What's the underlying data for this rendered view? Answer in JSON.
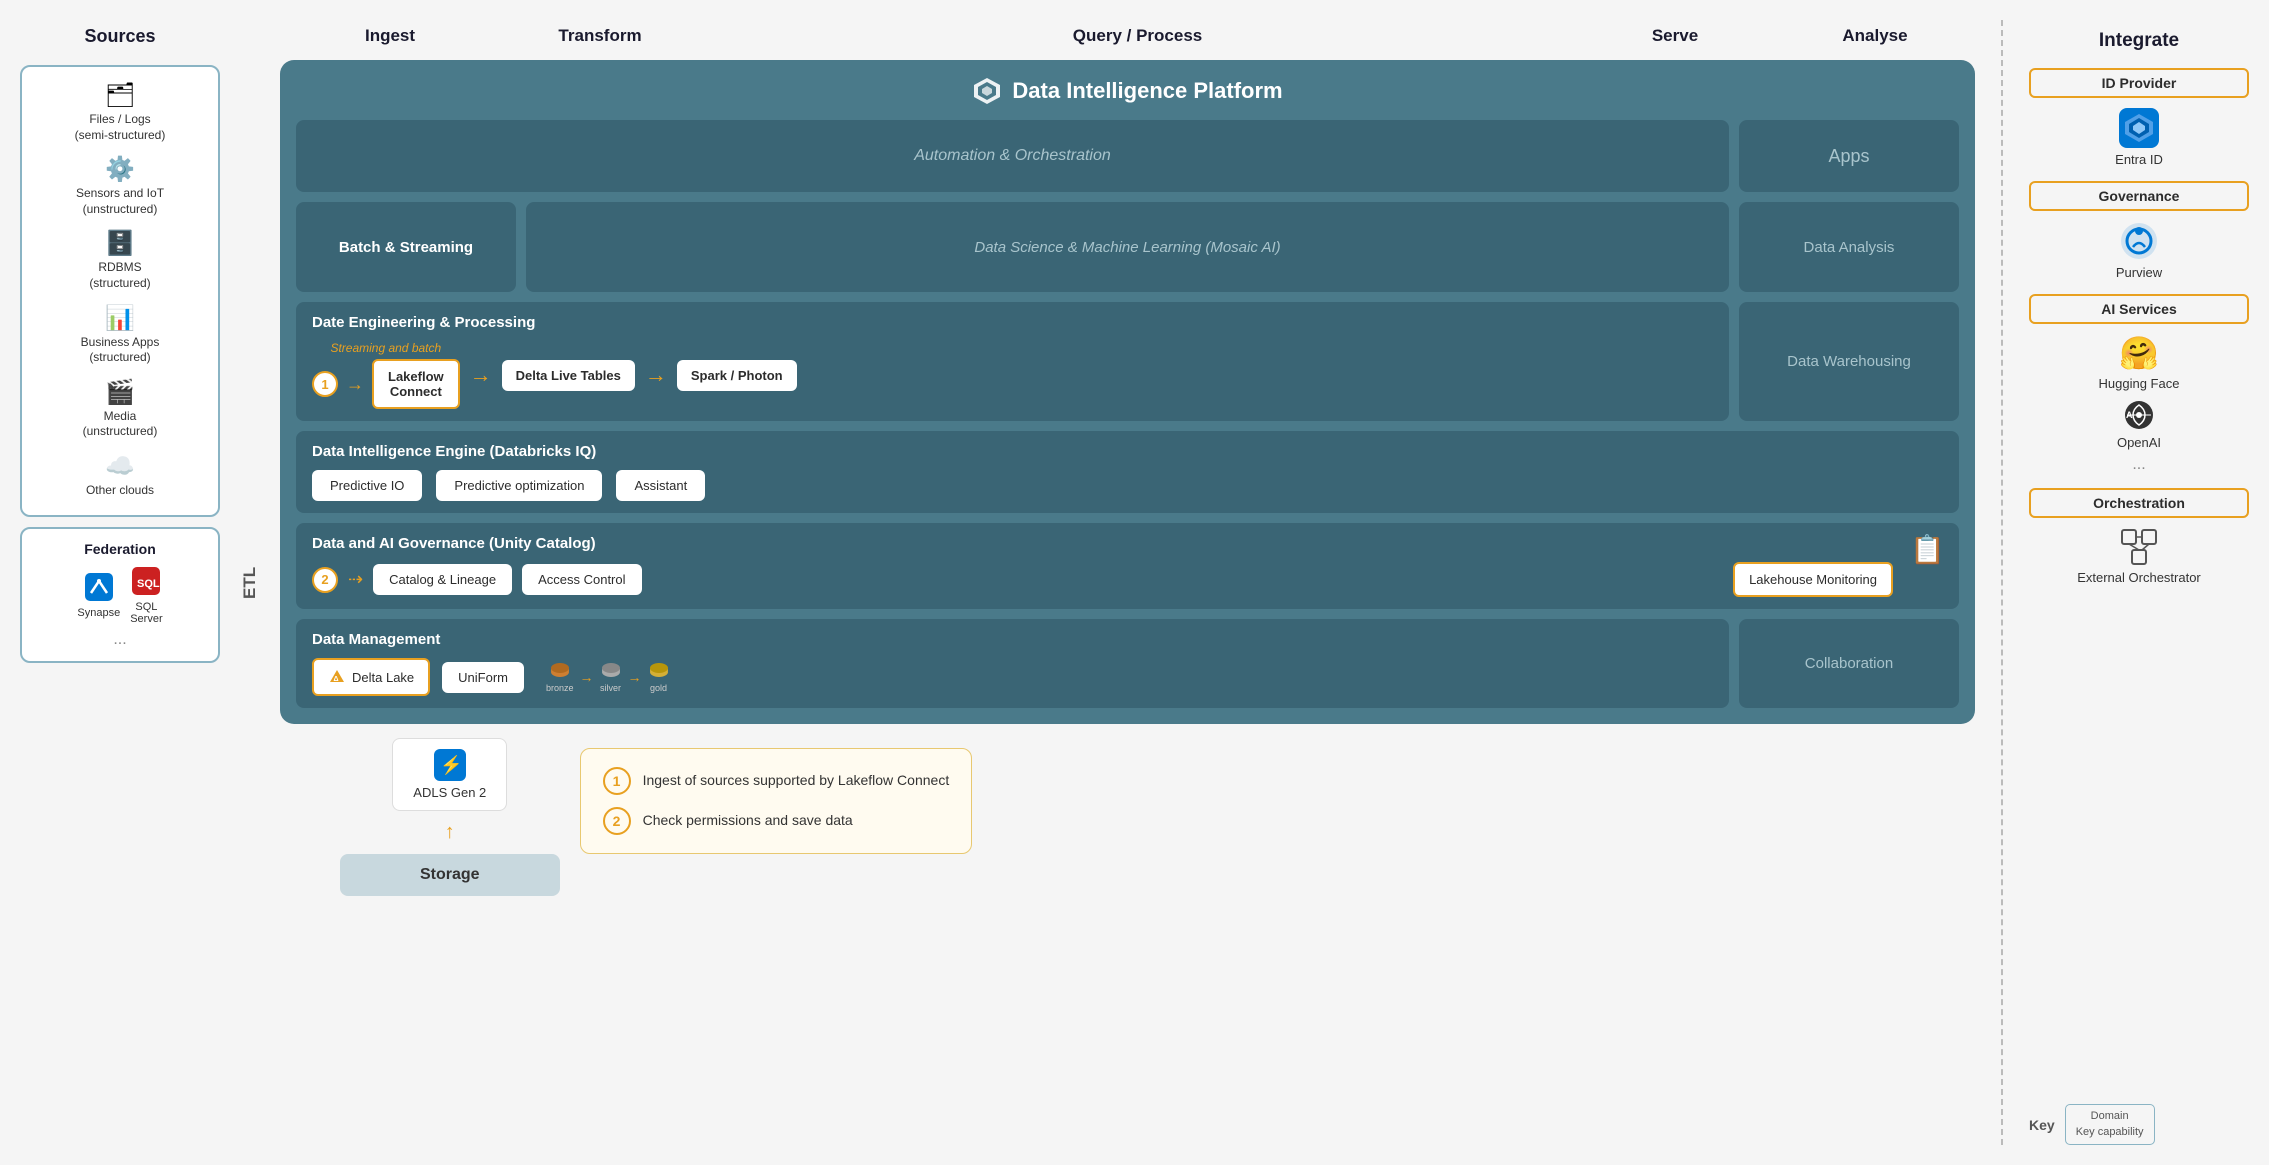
{
  "header": {
    "sources": "Sources",
    "ingest": "Ingest",
    "transform": "Transform",
    "query_process": "Query / Process",
    "serve": "Serve",
    "analyse": "Analyse",
    "integrate": "Integrate",
    "etl": "ETL",
    "federation": "Federation"
  },
  "sources": {
    "items": [
      {
        "icon": "🗂",
        "label": "Files / Logs\n(semi-structured)"
      },
      {
        "icon": "📡",
        "label": "Sensors and IoT\n(unstructured)"
      },
      {
        "icon": "🗄",
        "label": "RDBMS\n(structured)"
      },
      {
        "icon": "📊",
        "label": "Business Apps\n(structured)"
      },
      {
        "icon": "🎬",
        "label": "Media\n(unstructured)"
      },
      {
        "icon": "☁",
        "label": "Other clouds"
      }
    ]
  },
  "federation": {
    "items": [
      {
        "icon": "🔷",
        "label": "Synapse"
      },
      {
        "icon": "🗃",
        "label": "SQL\nServer"
      },
      {
        "label": "..."
      }
    ]
  },
  "platform": {
    "title": "Data Intelligence Platform",
    "automation_label": "Automation & Orchestration",
    "apps_label": "Apps",
    "batch_streaming_label": "Batch & Streaming",
    "datascience_label": "Data Science & Machine Learning  (Mosaic AI)",
    "dataanalysis_label": "Data Analysis",
    "engineering_title": "Date Engineering & Processing",
    "lakeflow_label": "Lakeflow\nConnect",
    "delta_live_label": "Delta Live\nTables",
    "spark_photon_label": "Spark /\nPhoton",
    "datawarehouse_label": "Data Warehousing",
    "intelligence_title": "Data Intelligence Engine  (Databricks IQ)",
    "predictive_io_label": "Predictive IO",
    "predictive_opt_label": "Predictive\noptimization",
    "assistant_label": "Assistant",
    "governance_title": "Data and AI Governance  (Unity Catalog)",
    "catalog_lineage_label": "Catalog &\nLineage",
    "access_control_label": "Access\nControl",
    "lakehouse_monitoring_label": "Lakehouse\nMonitoring",
    "management_title": "Data Management",
    "delta_lake_label": "Delta\nLake",
    "uniform_label": "UniForm",
    "bronze_label": "bronze",
    "silver_label": "silver",
    "gold_label": "gold",
    "collaboration_label": "Collaboration",
    "streaming_label": "Streaming and batch",
    "storage_label": "Storage",
    "adls_label": "ADLS Gen 2"
  },
  "legend": {
    "num1": "1",
    "text1": "Ingest of sources supported by Lakeflow Connect",
    "num2": "2",
    "text2": "Check permissions and save data"
  },
  "integrate": {
    "header": "Integrate",
    "id_provider_label": "ID Provider",
    "entra_id_label": "Entra ID",
    "governance_label": "Governance",
    "purview_label": "Purview",
    "ai_services_label": "AI Services",
    "hugging_face_label": "Hugging Face",
    "openai_label": "OpenAI",
    "dots": "...",
    "orchestration_label": "Orchestration",
    "external_orchestrator_label": "External\nOrchestrator"
  },
  "key": {
    "label": "Key",
    "domain_label": "Domain",
    "capability_label": "Key capability"
  }
}
